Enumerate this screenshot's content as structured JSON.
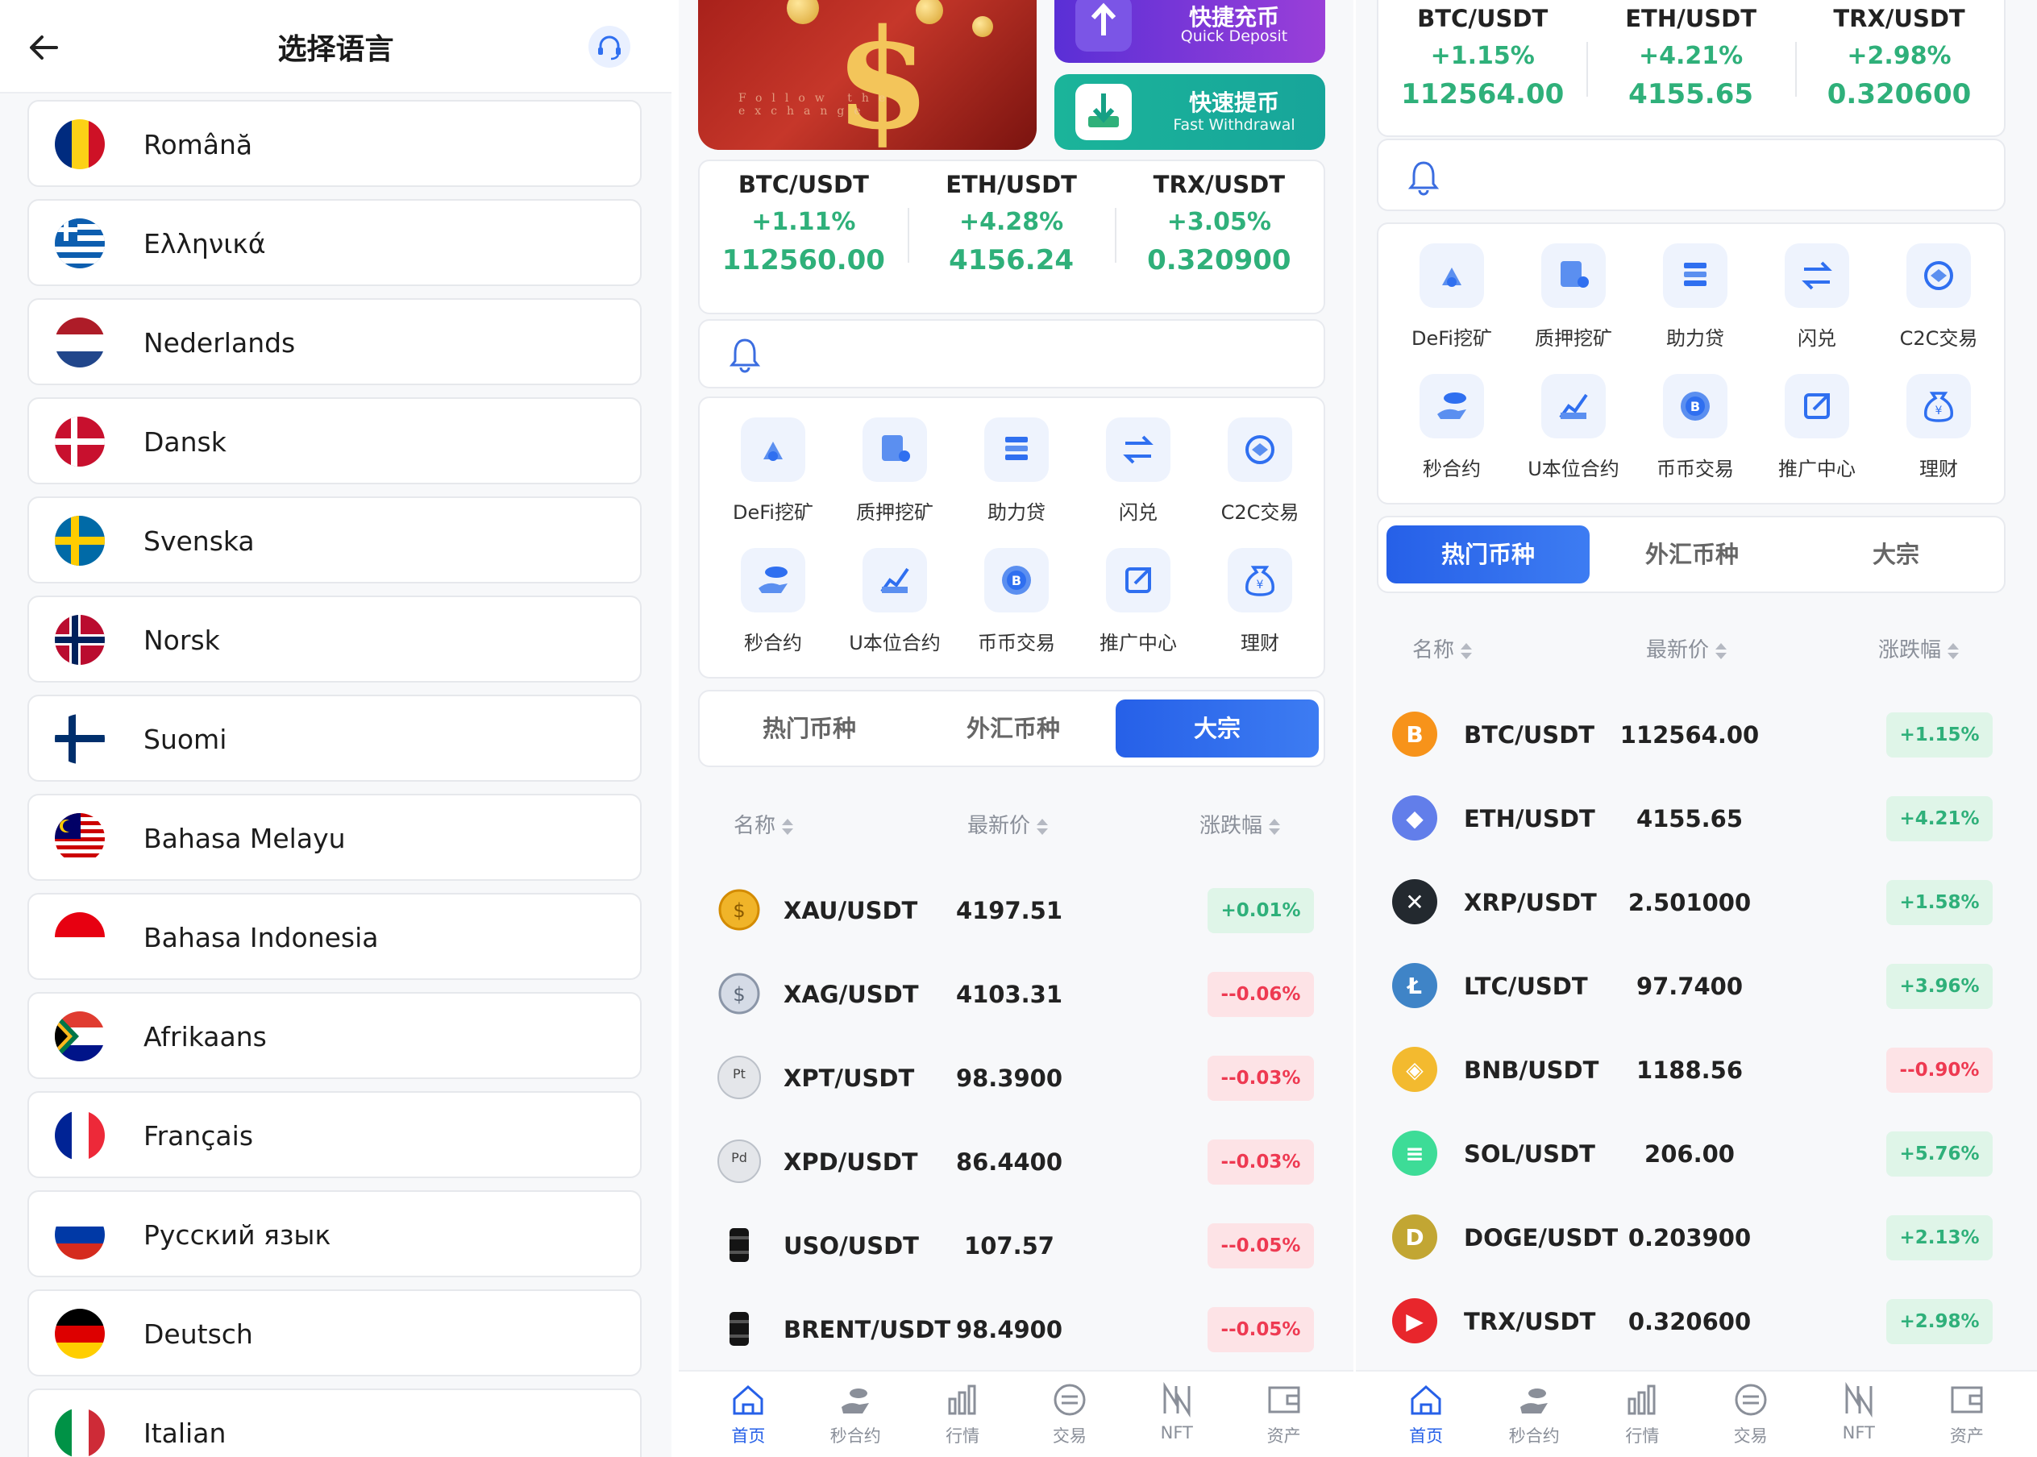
{
  "colors": {
    "accent": "#2660e8",
    "up": "#2fb07a",
    "down": "#ee3a52"
  },
  "language_page": {
    "title": "选择语言",
    "back_icon": "arrow-left-icon",
    "service_icon": "headset-icon",
    "languages": [
      {
        "label": "Română",
        "flag": "romania"
      },
      {
        "label": "Ελληνικά",
        "flag": "greece"
      },
      {
        "label": "Nederlands",
        "flag": "netherlands"
      },
      {
        "label": "Dansk",
        "flag": "denmark"
      },
      {
        "label": "Svenska",
        "flag": "sweden"
      },
      {
        "label": "Norsk",
        "flag": "norway"
      },
      {
        "label": "Suomi",
        "flag": "finland"
      },
      {
        "label": "Bahasa Melayu",
        "flag": "malaysia"
      },
      {
        "label": "Bahasa Indonesia",
        "flag": "indonesia"
      },
      {
        "label": "Afrikaans",
        "flag": "south-africa"
      },
      {
        "label": "Français",
        "flag": "france"
      },
      {
        "label": "Русский язык",
        "flag": "russia"
      },
      {
        "label": "Deutsch",
        "flag": "germany"
      },
      {
        "label": "Italian",
        "flag": "italy"
      }
    ]
  },
  "home_a": {
    "banner_text": "Follow the exchange",
    "deposit": {
      "cn": "快捷充币",
      "en": "Quick Deposit"
    },
    "withdraw": {
      "cn": "快速提币",
      "en": "Fast Withdrawal"
    },
    "tickers": [
      {
        "pair": "BTC/USDT",
        "change": "+1.11%",
        "price": "112560.00"
      },
      {
        "pair": "ETH/USDT",
        "change": "+4.28%",
        "price": "4156.24"
      },
      {
        "pair": "TRX/USDT",
        "change": "+3.05%",
        "price": "0.320900"
      }
    ],
    "menu": [
      "DeFi挖矿",
      "质押挖矿",
      "助力贷",
      "闪兑",
      "C2C交易",
      "秒合约",
      "U本位合约",
      "币币交易",
      "推广中心",
      "理财"
    ],
    "tabs": [
      "热门币种",
      "外汇币种",
      "大宗"
    ],
    "active_tab": 2,
    "columns": [
      "名称",
      "最新价",
      "涨跌幅"
    ],
    "rows": [
      {
        "symbol": "XAU/USDT",
        "price": "4197.51",
        "change": "+0.01%",
        "dir": "up",
        "icon": "gold-coin-icon"
      },
      {
        "symbol": "XAG/USDT",
        "price": "4103.31",
        "change": "-0.06%",
        "dir": "down",
        "icon": "silver-coin-icon"
      },
      {
        "symbol": "XPT/USDT",
        "price": "98.3900",
        "change": "-0.03%",
        "dir": "down",
        "icon": "platinum-coin-icon",
        "icon_text": "Pt"
      },
      {
        "symbol": "XPD/USDT",
        "price": "86.4400",
        "change": "-0.03%",
        "dir": "down",
        "icon": "palladium-coin-icon",
        "icon_text": "Pd"
      },
      {
        "symbol": "USO/USDT",
        "price": "107.57",
        "change": "-0.05%",
        "dir": "down",
        "icon": "oil-barrel-icon"
      },
      {
        "symbol": "BRENT/USDT",
        "price": "98.4900",
        "change": "-0.05%",
        "dir": "down",
        "icon": "brent-barrel-icon"
      }
    ]
  },
  "home_b": {
    "tickers": [
      {
        "pair": "BTC/USDT",
        "change": "+1.15%",
        "price": "112564.00"
      },
      {
        "pair": "ETH/USDT",
        "change": "+4.21%",
        "price": "4155.65"
      },
      {
        "pair": "TRX/USDT",
        "change": "+2.98%",
        "price": "0.320600"
      }
    ],
    "menu": [
      "DeFi挖矿",
      "质押挖矿",
      "助力贷",
      "闪兑",
      "C2C交易",
      "秒合约",
      "U本位合约",
      "币币交易",
      "推广中心",
      "理财"
    ],
    "tabs": [
      "热门币种",
      "外汇币种",
      "大宗"
    ],
    "active_tab": 0,
    "columns": [
      "名称",
      "最新价",
      "涨跌幅"
    ],
    "rows": [
      {
        "symbol": "BTC/USDT",
        "price": "112564.00",
        "change": "+1.15%",
        "dir": "up",
        "icon": "bitcoin-icon",
        "color": "#f7931a",
        "glyph": "B"
      },
      {
        "symbol": "ETH/USDT",
        "price": "4155.65",
        "change": "+4.21%",
        "dir": "up",
        "icon": "ethereum-icon",
        "color": "#627eea",
        "glyph": "◆"
      },
      {
        "symbol": "XRP/USDT",
        "price": "2.501000",
        "change": "+1.58%",
        "dir": "up",
        "icon": "xrp-icon",
        "color": "#23292f",
        "glyph": "✕"
      },
      {
        "symbol": "LTC/USDT",
        "price": "97.7400",
        "change": "+3.96%",
        "dir": "up",
        "icon": "litecoin-icon",
        "color": "#3f84c7",
        "glyph": "Ł"
      },
      {
        "symbol": "BNB/USDT",
        "price": "1188.56",
        "change": "-0.90%",
        "dir": "down",
        "icon": "bnb-icon",
        "color": "#f3ba2f",
        "glyph": "◈"
      },
      {
        "symbol": "SOL/USDT",
        "price": "206.00",
        "change": "+5.76%",
        "dir": "up",
        "icon": "solana-icon",
        "color": "#3ddc97",
        "glyph": "≡"
      },
      {
        "symbol": "DOGE/USDT",
        "price": "0.203900",
        "change": "+2.13%",
        "dir": "up",
        "icon": "dogecoin-icon",
        "color": "#c2a633",
        "glyph": "D"
      },
      {
        "symbol": "TRX/USDT",
        "price": "0.320600",
        "change": "+2.98%",
        "dir": "up",
        "icon": "tron-icon",
        "color": "#e8262c",
        "glyph": "▶"
      }
    ]
  },
  "nav": [
    "首页",
    "秒合约",
    "行情",
    "交易",
    "NFT",
    "资产"
  ]
}
